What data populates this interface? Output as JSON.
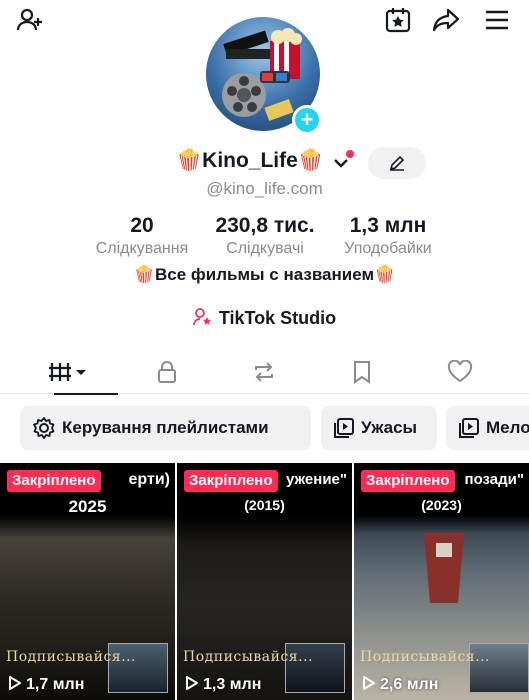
{
  "header": {
    "add_friend_icon": "person-plus-icon",
    "calendar_icon": "calendar-star-icon",
    "share_icon": "share-arrow-icon",
    "menu_icon": "hamburger-menu-icon"
  },
  "profile": {
    "display_name": "🍿Kino_Life🍿",
    "username": "@kino_life.com",
    "bio": "🍿Все фильмы с названием🍿",
    "studio_link": "TikTok Studio",
    "add_badge": "+"
  },
  "stats": [
    {
      "value": "20",
      "label": "Слідкування"
    },
    {
      "value": "230,8 тис.",
      "label": "Слідкувачі"
    },
    {
      "value": "1,3 млн",
      "label": "Уподобайки"
    }
  ],
  "tabs": [
    {
      "icon": "videos-grid-icon",
      "selected": true
    },
    {
      "icon": "lock-icon"
    },
    {
      "icon": "repost-icon"
    },
    {
      "icon": "bookmark-icon"
    },
    {
      "icon": "heart-icon"
    }
  ],
  "chips": [
    {
      "label": "Керування плейлистами",
      "icon": "gear-icon"
    },
    {
      "label": "Ужасы",
      "icon": "playlist-icon"
    },
    {
      "label": "Мело",
      "icon": "playlist-icon"
    }
  ],
  "videos": [
    {
      "pinned": "Закріплено",
      "caption_top": "ерти)",
      "caption_year": "2025",
      "promo": "Подписывайся...",
      "views": "1,7 млн"
    },
    {
      "pinned": "Закріплено",
      "caption_top": "ужение\"",
      "caption_year": "(2015)",
      "promo": "Подписывайся...",
      "views": "1,3 млн"
    },
    {
      "pinned": "Закріплено",
      "caption_top": "позади\"",
      "caption_year": "(2023)",
      "promo": "Подписывайся...",
      "views": "2,6 млн"
    }
  ],
  "colors": {
    "accent": "#fe2c55",
    "badge": "#20d5ec",
    "text_secondary": "#8a8b91",
    "chip_bg": "#f1f1f2"
  }
}
